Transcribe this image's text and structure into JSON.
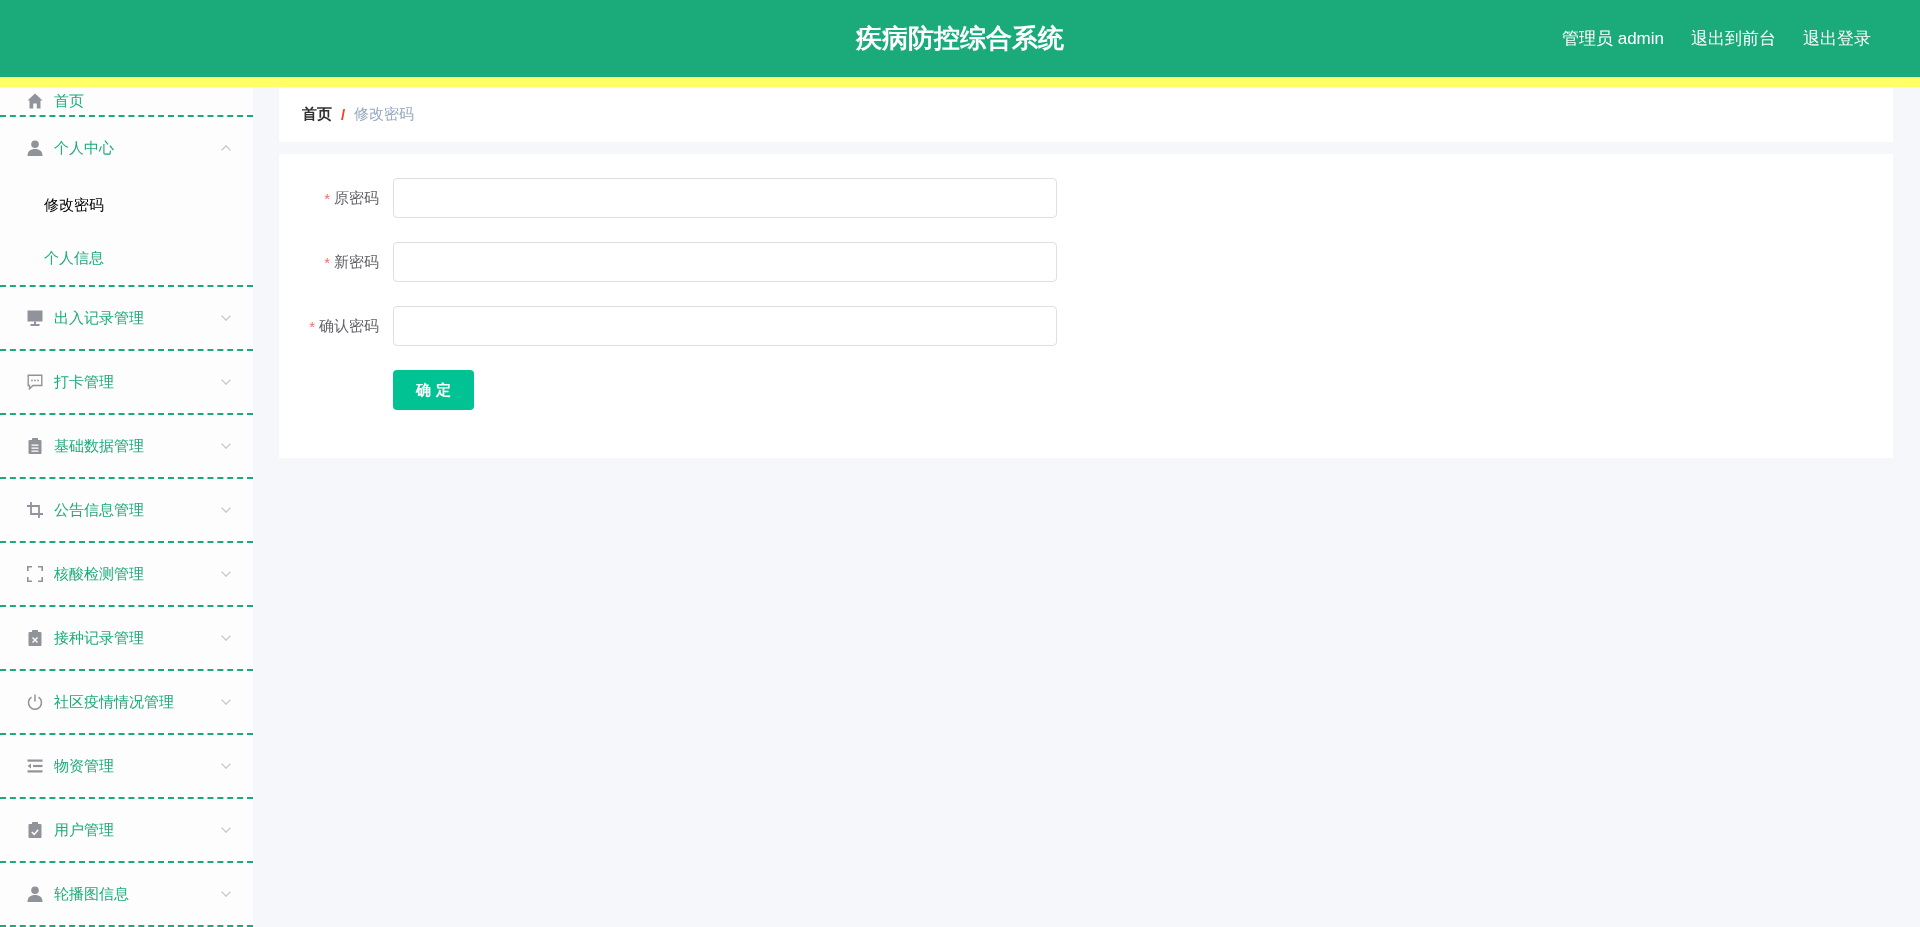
{
  "header": {
    "title": "疾病防控综合系统",
    "user": "管理员 admin",
    "links": [
      "退出到前台",
      "退出登录"
    ]
  },
  "sidebar": {
    "items": [
      {
        "kind": "link",
        "label": "首页"
      },
      {
        "kind": "menu",
        "label": "个人中心",
        "expanded": true,
        "children": [
          {
            "label": "修改密码",
            "selected": true
          },
          {
            "label": "个人信息",
            "selected": false
          }
        ]
      },
      {
        "kind": "menu",
        "label": "出入记录管理",
        "expanded": false
      },
      {
        "kind": "menu",
        "label": "打卡管理",
        "expanded": false
      },
      {
        "kind": "menu",
        "label": "基础数据管理",
        "expanded": false
      },
      {
        "kind": "menu",
        "label": "公告信息管理",
        "expanded": false
      },
      {
        "kind": "menu",
        "label": "核酸检测管理",
        "expanded": false
      },
      {
        "kind": "menu",
        "label": "接种记录管理",
        "expanded": false
      },
      {
        "kind": "menu",
        "label": "社区疫情情况管理",
        "expanded": false
      },
      {
        "kind": "menu",
        "label": "物资管理",
        "expanded": false
      },
      {
        "kind": "menu",
        "label": "用户管理",
        "expanded": false
      },
      {
        "kind": "menu",
        "label": "轮播图信息",
        "expanded": false
      }
    ]
  },
  "breadcrumb": {
    "items": [
      "首页",
      "修改密码"
    ],
    "separator": "/"
  },
  "form": {
    "required_mark": "*",
    "fields": [
      {
        "label": "原密码",
        "required": true
      },
      {
        "label": "新密码",
        "required": true
      },
      {
        "label": "确认密码",
        "required": true
      }
    ],
    "submit": "确 定"
  }
}
